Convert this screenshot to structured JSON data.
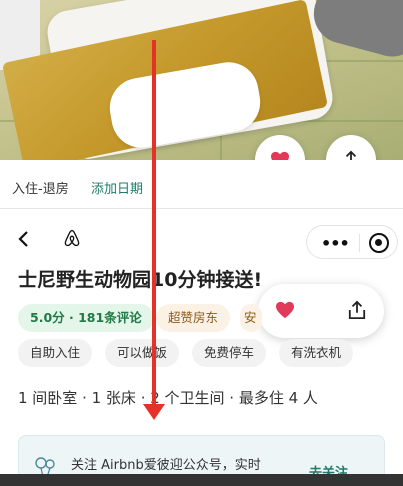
{
  "listing": {
    "checkin_label": "入住-退房",
    "add_date": "添加日期",
    "title": "士尼野生动物园10分钟接送!",
    "rating": "5.0分 · 181条评论",
    "superhost": "超赞房东",
    "partial_tag": "安",
    "features": [
      "自助入住",
      "可以做饭",
      "免费停车",
      "有洗衣机"
    ],
    "room_info": "1 间卧室 · 1 张床 · 2 个卫生间 · 最多住 4 人"
  },
  "banner": {
    "text": "关注 Airbnb爱彼迎公众号，实时",
    "follow": "去关注"
  },
  "icons": {
    "heart": "heart-icon",
    "share": "share-icon",
    "back": "chevron-left-icon",
    "logo": "airbnb-logo-icon",
    "more": "more-dots-icon",
    "close": "target-circle-icon"
  },
  "colors": {
    "heart": "#e0395a",
    "accent": "#1e7c6a",
    "annotation_arrow": "#e53226"
  }
}
